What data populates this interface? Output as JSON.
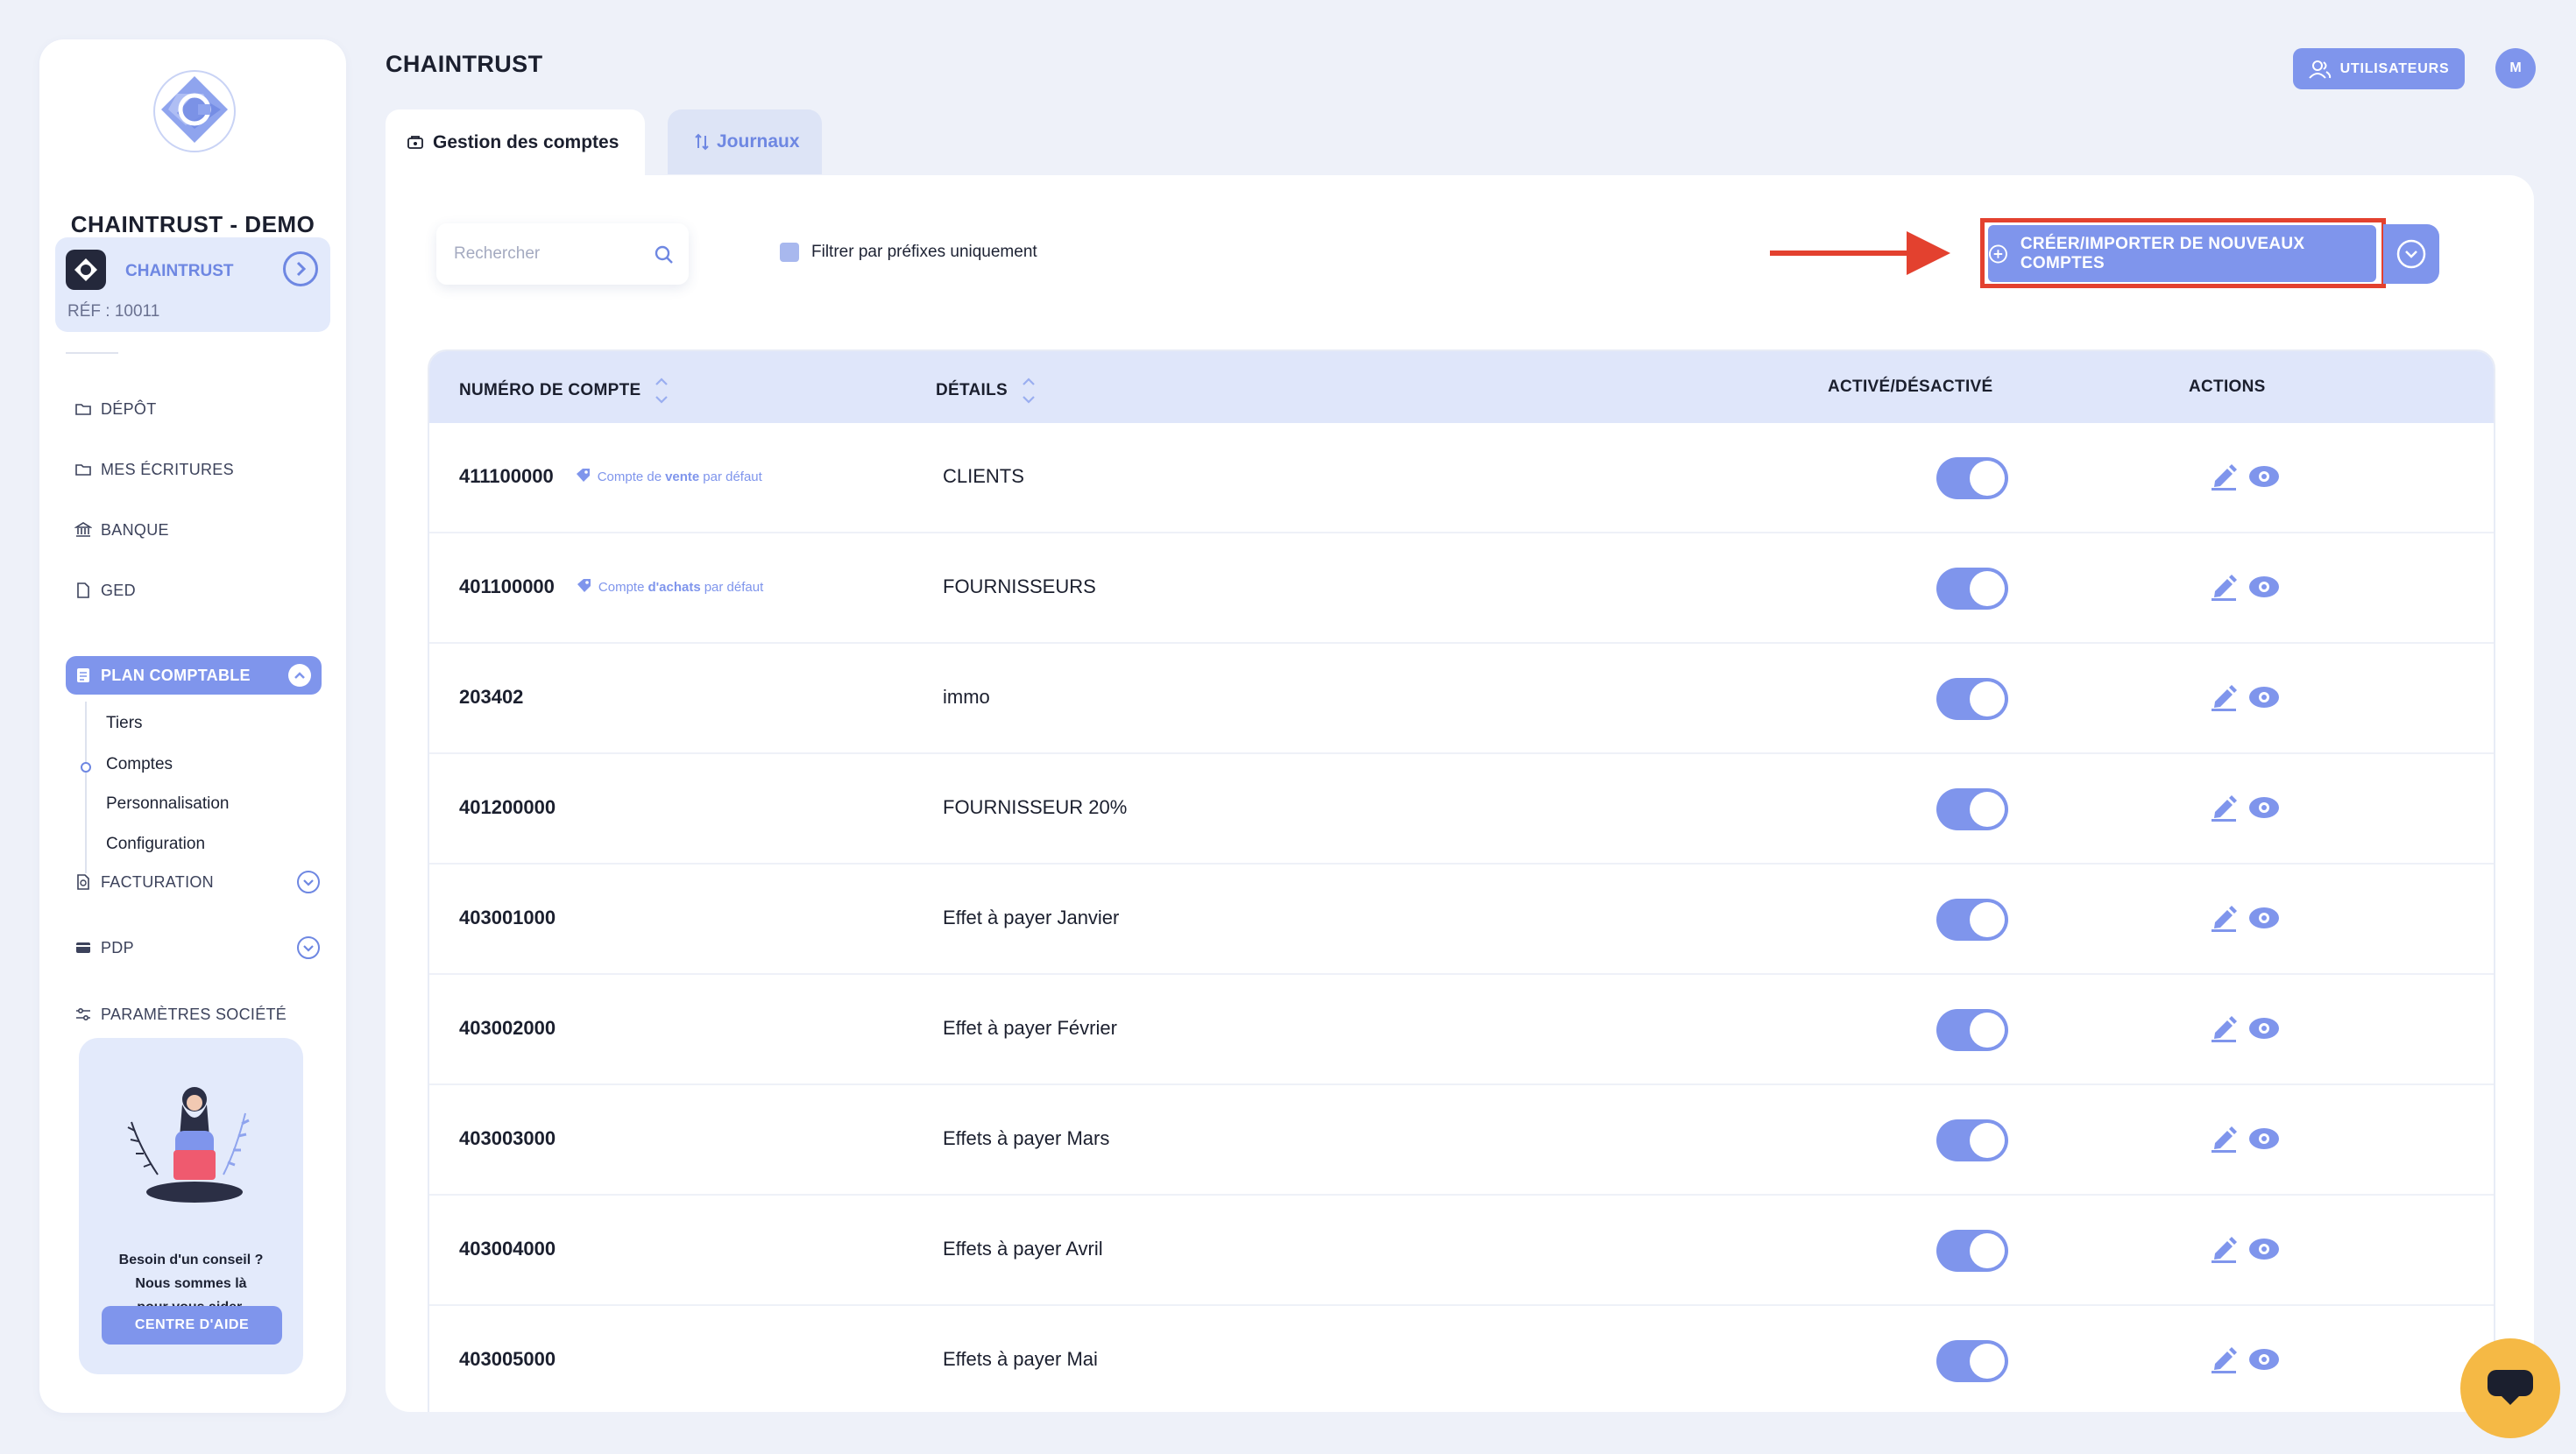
{
  "sidebar": {
    "company": "CHAINTRUST - DEMO",
    "org_name": "CHAINTRUST",
    "org_ref": "RÉF : 10011",
    "items": [
      {
        "label": "DÉPÔT",
        "icon": "folder-icon"
      },
      {
        "label": "MES ÉCRITURES",
        "icon": "folder-icon"
      },
      {
        "label": "BANQUE",
        "icon": "bank-icon"
      },
      {
        "label": "GED",
        "icon": "document-icon"
      },
      {
        "label": "PLAN COMPTABLE",
        "icon": "ledger-icon"
      },
      {
        "label": "FACTURATION",
        "icon": "invoice-icon"
      },
      {
        "label": "PDP",
        "icon": "card-icon"
      },
      {
        "label": "PARAMÈTRES SOCIÉTÉ",
        "icon": "sliders-icon"
      }
    ],
    "sub_items": [
      "Tiers",
      "Comptes",
      "Personnalisation",
      "Configuration"
    ],
    "help_line1": "Besoin d'un conseil ?",
    "help_line2": "Nous sommes là",
    "help_line3": "pour vous aider.",
    "help_button": "CENTRE D'AIDE"
  },
  "header": {
    "title": "CHAINTRUST",
    "users_button": "UTILISATEURS",
    "avatar_initial": "M"
  },
  "tabs": [
    {
      "label": "Gestion des comptes",
      "active": true
    },
    {
      "label": "Journaux",
      "active": false
    }
  ],
  "toolbar": {
    "search_placeholder": "Rechercher",
    "filter_label": "Filtrer par préfixes uniquement",
    "create_button": "CRÉER/IMPORTER DE NOUVEAUX COMPTES"
  },
  "table": {
    "columns": [
      "NUMÉRO DE COMPTE",
      "DÉTAILS",
      "ACTIVÉ/DÉSACTIVÉ",
      "ACTIONS"
    ],
    "rows": [
      {
        "number": "411100000",
        "tag_pre": "Compte de",
        "tag_bold": "vente",
        "tag_post": "par défaut",
        "details": "CLIENTS",
        "active": true
      },
      {
        "number": "401100000",
        "tag_pre": "Compte",
        "tag_bold": "d'achats",
        "tag_post": "par défaut",
        "details": "FOURNISSEURS",
        "active": true
      },
      {
        "number": "203402",
        "details": "immo",
        "active": true
      },
      {
        "number": "401200000",
        "details": "FOURNISSEUR 20%",
        "active": true
      },
      {
        "number": "403001000",
        "details": "Effet à payer Janvier",
        "active": true
      },
      {
        "number": "403002000",
        "details": "Effet à payer Février",
        "active": true
      },
      {
        "number": "403003000",
        "details": "Effets à payer Mars",
        "active": true
      },
      {
        "number": "403004000",
        "details": "Effets à payer Avril",
        "active": true
      },
      {
        "number": "403005000",
        "details": "Effets à payer Mai",
        "active": true
      }
    ]
  },
  "colors": {
    "accent": "#7f95ec",
    "highlight": "#e3412f",
    "chat": "#f5b945"
  }
}
